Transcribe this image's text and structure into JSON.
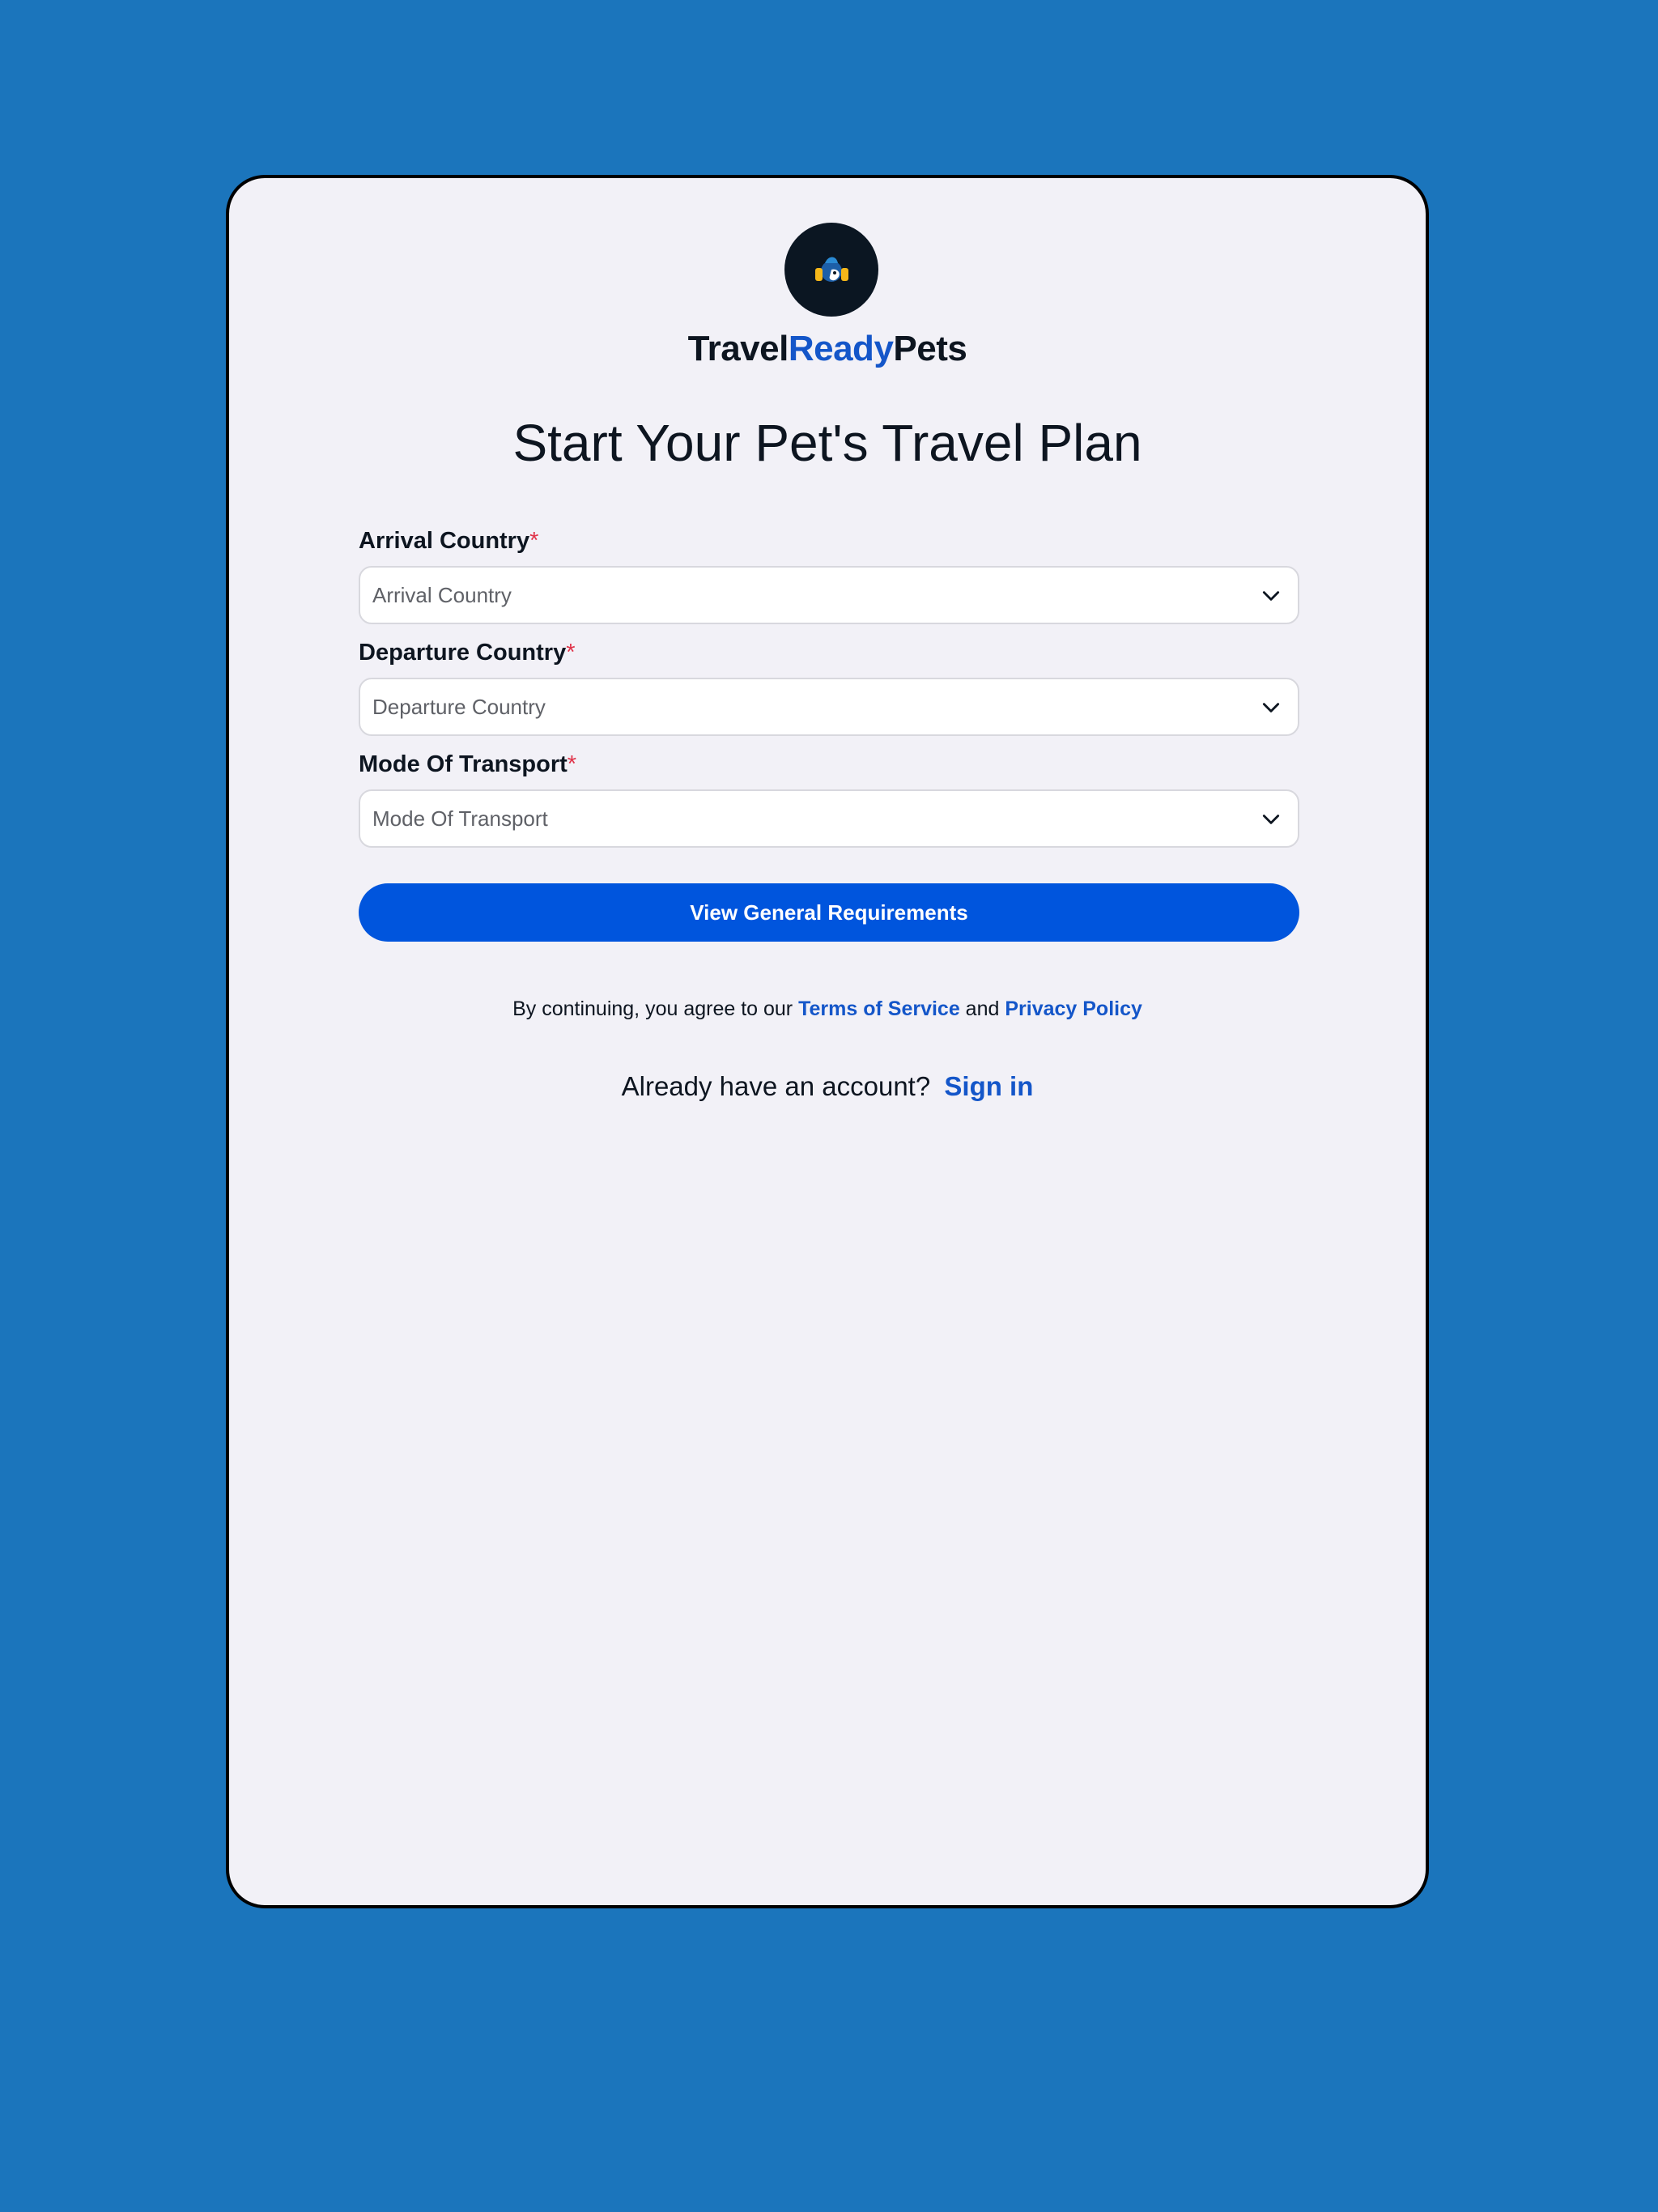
{
  "brand": {
    "part1": "Travel",
    "part2": "Ready",
    "part3": "Pets",
    "logo_icon": "pet-travel-logo-icon"
  },
  "title": "Start Your Pet's Travel Plan",
  "form": {
    "fields": [
      {
        "label": "Arrival Country",
        "required_mark": "*",
        "placeholder": "Arrival Country"
      },
      {
        "label": "Departure Country",
        "required_mark": "*",
        "placeholder": "Departure Country"
      },
      {
        "label": "Mode Of Transport",
        "required_mark": "*",
        "placeholder": "Mode Of Transport"
      }
    ],
    "submit_label": "View General Requirements"
  },
  "legal": {
    "prefix": "By continuing, you agree to our ",
    "terms_label": "Terms of Service",
    "and": " and ",
    "privacy_label": "Privacy Policy"
  },
  "signin": {
    "prompt": "Already have an account?",
    "link_label": "Sign in"
  },
  "colors": {
    "background": "#1b75bc",
    "card": "#f2f1f7",
    "accent": "#1456c9",
    "button": "#0055dd",
    "required": "#e0344a"
  }
}
